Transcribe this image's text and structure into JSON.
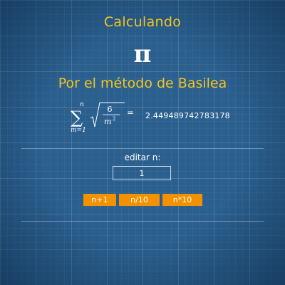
{
  "header": {
    "title": "Calculando",
    "symbol": "π",
    "subtitle": "Por el método de Basilea"
  },
  "formula": {
    "sum_symbol": "∑",
    "upper_limit": "n",
    "lower_limit": "m=1",
    "numerator": "6",
    "denominator_base": "m",
    "denominator_exp": "2",
    "equals": "=",
    "result": "2.449489742783178"
  },
  "editor": {
    "label": "editar n:",
    "value": "1"
  },
  "buttons": {
    "increment": "n+1",
    "divide": "n/10",
    "multiply": "n*10"
  },
  "colors": {
    "background": "#2a5f8e",
    "accent": "#f5c51d",
    "button": "#f39200",
    "text": "#ffffff"
  }
}
